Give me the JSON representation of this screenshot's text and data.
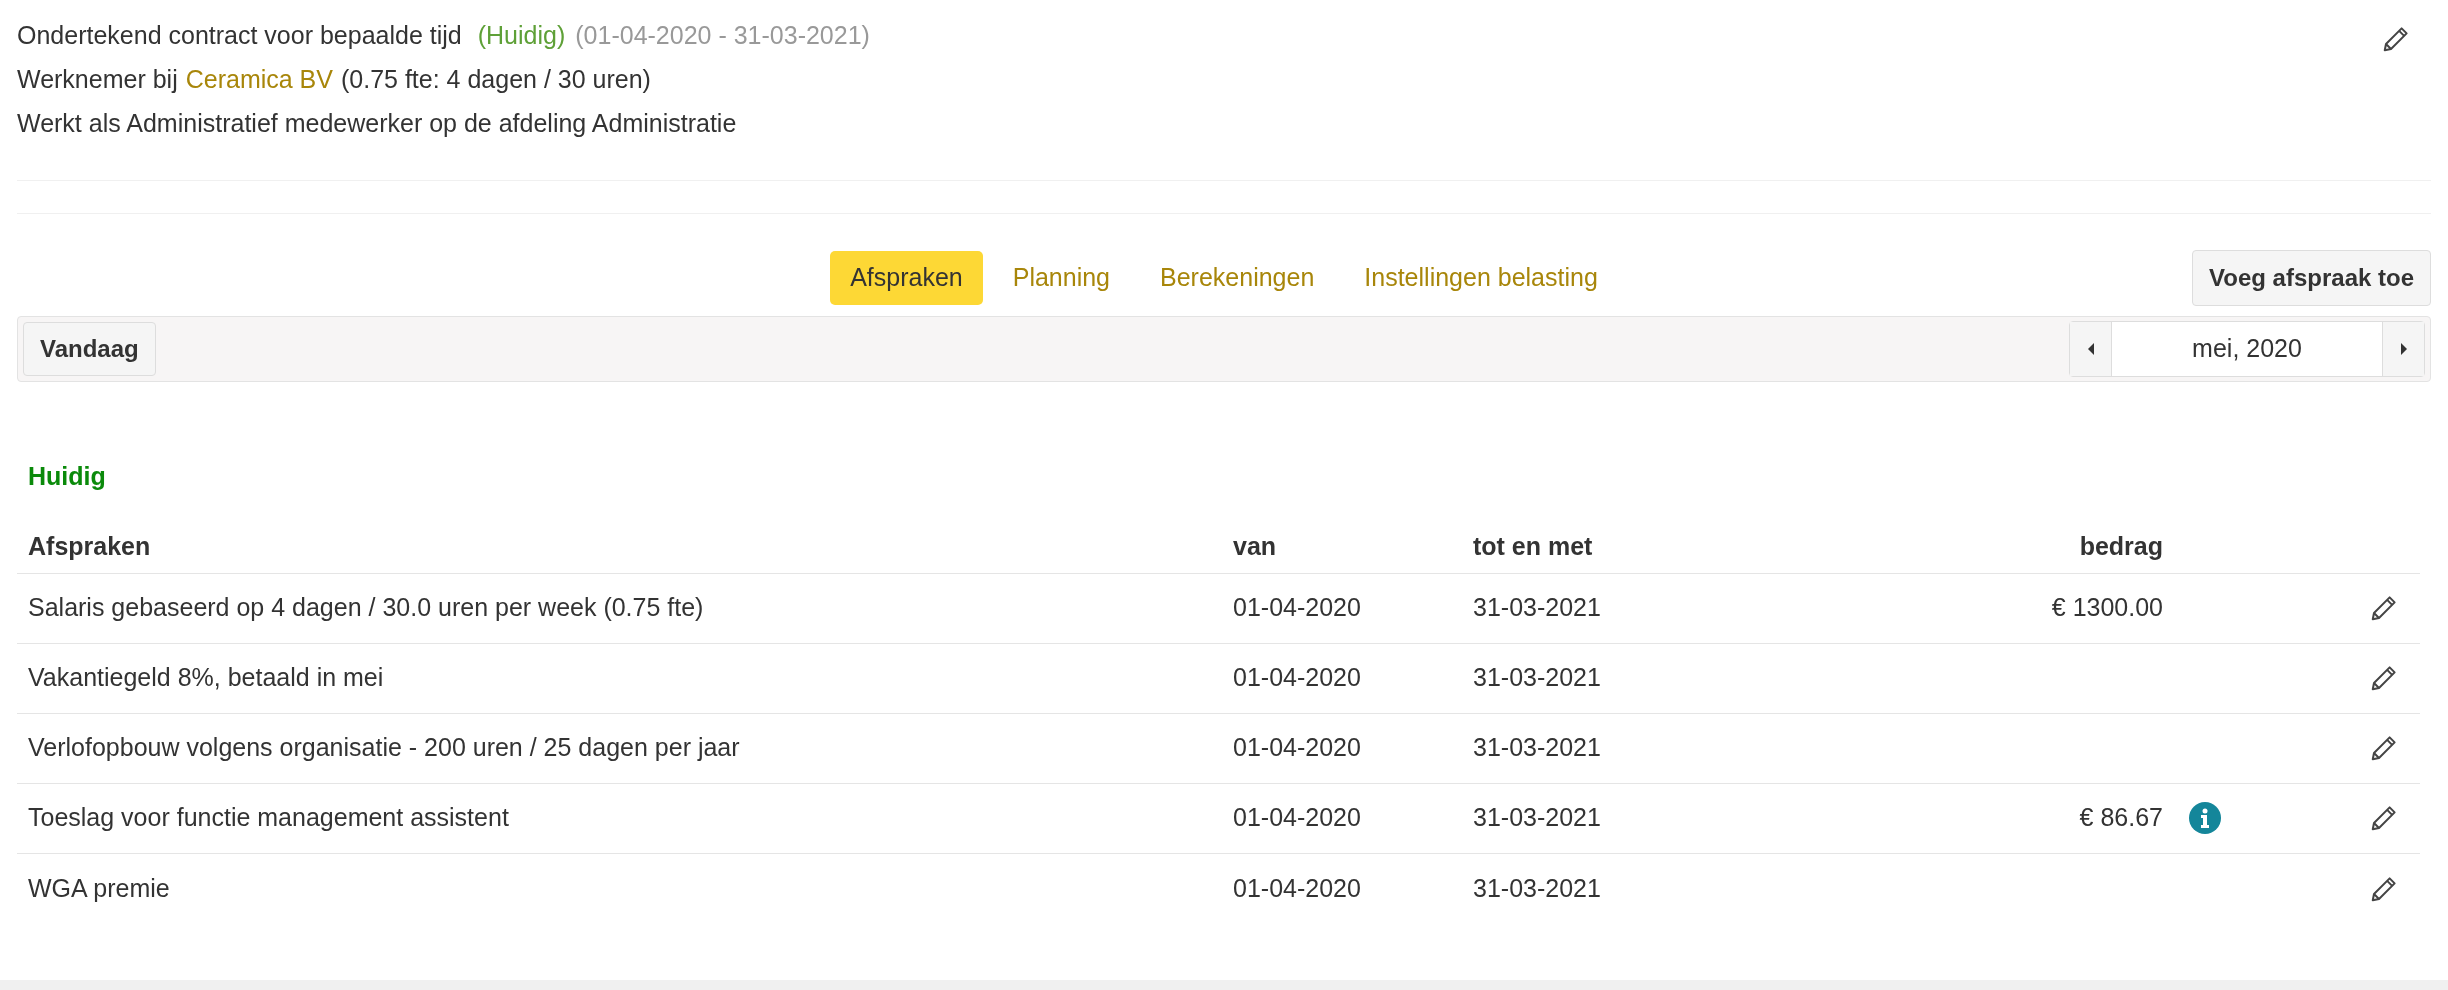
{
  "contract": {
    "title": "Ondertekend contract voor bepaalde tijd",
    "status": "(Huidig)",
    "period": "(01-04-2020 - 31-03-2021)",
    "employer_prefix": "Werknemer bij",
    "employer": "Ceramica BV",
    "employment": "(0.75 fte: 4 dagen / 30 uren)",
    "role": "Werkt als Administratief medewerker op de afdeling Administratie"
  },
  "tabs": [
    {
      "label": "Afspraken",
      "selected": true
    },
    {
      "label": "Planning",
      "selected": false
    },
    {
      "label": "Berekeningen",
      "selected": false
    },
    {
      "label": "Instellingen belasting",
      "selected": false
    }
  ],
  "add_button": "Voeg afspraak toe",
  "toolbar": {
    "today_button": "Vandaag",
    "month": "mei, 2020"
  },
  "section_title": "Huidig",
  "table": {
    "columns": [
      "Afspraken",
      "van",
      "tot en met",
      "bedrag"
    ],
    "rows": [
      {
        "description": "Salaris gebaseerd op 4 dagen / 30.0 uren per week (0.75 fte)",
        "from": "01-04-2020",
        "to": "31-03-2021",
        "amount": "€ 1300.00",
        "info": false
      },
      {
        "description": "Vakantiegeld 8%, betaald in mei",
        "from": "01-04-2020",
        "to": "31-03-2021",
        "info": false
      },
      {
        "description": "Verlofopbouw volgens organisatie - 200 uren / 25 dagen per jaar",
        "from": "01-04-2020",
        "to": "31-03-2021",
        "info": false
      },
      {
        "description": "Toeslag voor functie management assistent",
        "from": "01-04-2020",
        "to": "31-03-2021",
        "amount": "€ 86.67",
        "info": true
      },
      {
        "description": "WGA premie",
        "from": "01-04-2020",
        "to": "31-03-2021",
        "info": false
      }
    ]
  }
}
